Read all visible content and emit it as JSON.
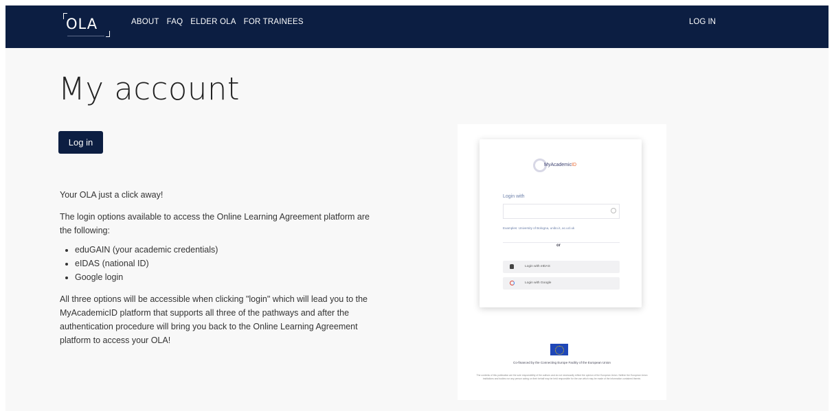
{
  "nav": {
    "logo_text": "OLA",
    "menu": [
      {
        "label": "ABOUT"
      },
      {
        "label": "FAQ"
      },
      {
        "label": "ELDER OLA"
      },
      {
        "label": "FOR TRAINEES"
      }
    ],
    "login_label": "LOG IN"
  },
  "main": {
    "title": "My account",
    "login_button": "Log in",
    "intro": "Your OLA just a click away!",
    "options_intro": "The login options available to access the Online Learning Agreement platform are the following:",
    "options": [
      "eduGAIN (your academic credentials)",
      "eIDAS (national ID)",
      "Google login"
    ],
    "closing": "All three options will be accessible when clicking \"login\" which will lead you to the MyAcademicID platform that supports all three of the pathways and after the authentication procedure will bring you back to the Online Learning Agreement platform to access your OLA!"
  },
  "preview": {
    "logo_name_prefix": "MyAcademic",
    "logo_name_suffix": "ID",
    "login_with": "Login with",
    "examples": "Examples: University of Bologna, unibo.it, ac.ucl.uk",
    "or": "or",
    "eidas_label": "Login with eIDAS",
    "google_label": "Login with Google",
    "cofunded": "Co-financed by the Connecting Europe Facility of the European Union",
    "disclaimer": "The contents of this publication are the sole responsibility of the authors and do not necessarily reflect the opinion of the European Union. Neither the European Union institutions and bodies nor any person acting on their behalf may be held responsible for the use which may be made of the information contained therein."
  },
  "colors": {
    "nav_bg": "#0c1e42",
    "button_bg": "#0c1e42",
    "page_bg": "#f8f8f8"
  }
}
